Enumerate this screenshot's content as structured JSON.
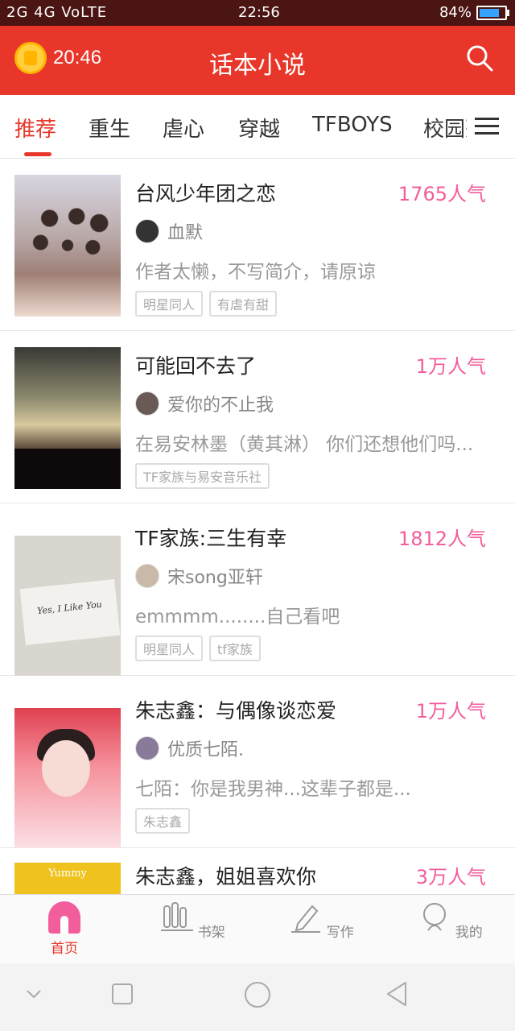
{
  "status_bar": {
    "left": "2G 4G VoLTE",
    "time": "22:56",
    "battery": "84%"
  },
  "app_bar": {
    "clock_time": "20:46",
    "title": "话本小说"
  },
  "tabs": [
    "推荐",
    "重生",
    "虐心",
    "穿越",
    "TFBOYS",
    "校园死"
  ],
  "books": [
    {
      "title": "台风少年团之恋",
      "popularity": "1765人气",
      "author": "血默",
      "description": "作者太懒，不写简介，请原谅",
      "tags": [
        "明星同人",
        "有虐有甜"
      ]
    },
    {
      "title": "可能回不去了",
      "popularity": "1万人气",
      "author": "爱你的不止我",
      "description": "在易安林墨（黄其淋） 你们还想他们吗...",
      "tags": [
        "TF家族与易安音乐社"
      ]
    },
    {
      "title": "TF家族:三生有幸",
      "popularity": "1812人气",
      "author": "宋song亚轩",
      "description": "emmmm........自己看吧",
      "tags": [
        "明星同人",
        "tf家族"
      ],
      "cover_text": "Yes, I Like You"
    },
    {
      "title": "朱志鑫：与偶像谈恋爱",
      "popularity": "1万人气",
      "author": "优质七陌.",
      "description": "七陌：你是我男神...这辈子都是...",
      "tags": [
        "朱志鑫"
      ]
    },
    {
      "title": "朱志鑫，姐姐喜欢你",
      "popularity": "3万人气",
      "cover_text": "Yummy"
    }
  ],
  "bottom_nav": [
    "首页",
    "书架",
    "写作",
    "我的"
  ],
  "colors": {
    "primary": "#e8372a",
    "popularity": "#f25d9c"
  }
}
